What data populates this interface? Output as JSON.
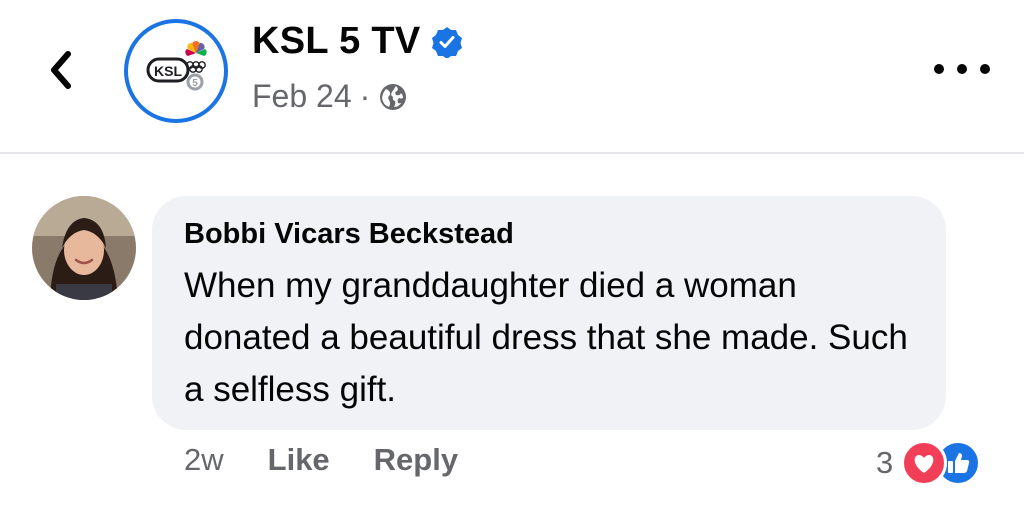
{
  "header": {
    "page_name": "KSL 5 TV",
    "date": "Feb 24",
    "separator": "·",
    "icons": [
      "back-chevron-icon",
      "verified-badge-icon",
      "globe-icon",
      "more-dots-icon"
    ],
    "logo_text": "KSL"
  },
  "comment": {
    "author": "Bobbi Vicars Beckstead",
    "text": "When my granddaughter died a woman donated a beautiful dress that she made. Such a selfless gift.",
    "age": "2w",
    "like_label": "Like",
    "reply_label": "Reply",
    "reaction_count": "3",
    "reaction_icons": [
      "love-reaction-icon",
      "like-reaction-icon"
    ]
  },
  "colors": {
    "accent": "#1b74e4",
    "love": "#f33e58",
    "bubble": "#f0f2f5",
    "secondary_text": "#65676b"
  }
}
